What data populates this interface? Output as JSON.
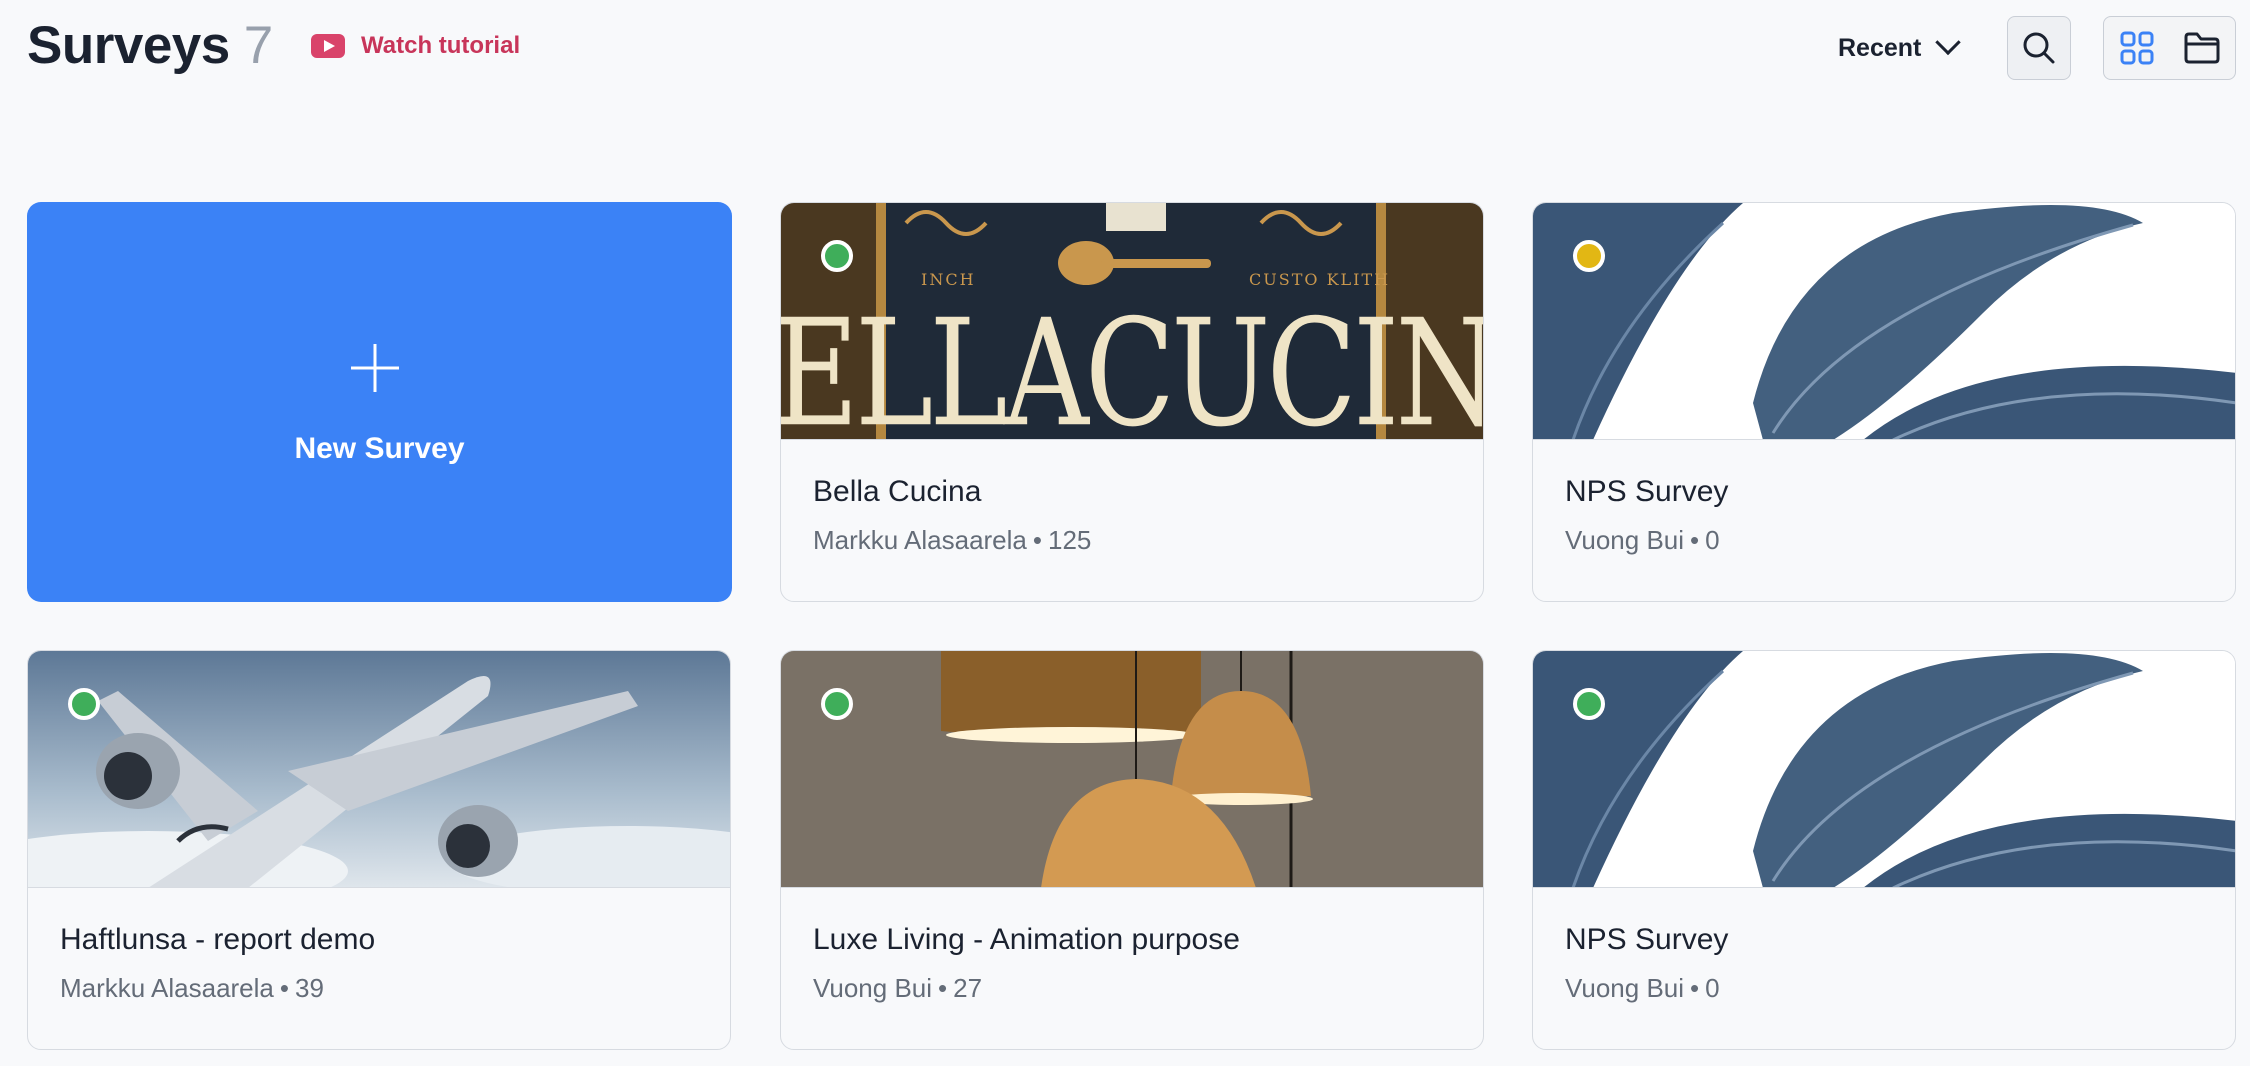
{
  "header": {
    "title": "Surveys",
    "count": "7",
    "tutorial_label": "Watch tutorial",
    "sort_label": "Recent"
  },
  "new_survey": {
    "label": "New Survey"
  },
  "status_colors": {
    "active": "#3fae5a",
    "paused": "#e2b714"
  },
  "accent": "#3b82f6",
  "cards": [
    {
      "name": "Bella Cucina",
      "author": "Markku Alasaarela",
      "responses": "125",
      "status": "active",
      "image": "bella-cucina-sign"
    },
    {
      "name": "NPS Survey",
      "author": "Vuong Bui",
      "responses": "0",
      "status": "paused",
      "image": "blue-leaves"
    },
    {
      "name": "Haftlunsa - report demo",
      "author": "Markku Alasaarela",
      "responses": "39",
      "status": "active",
      "image": "airplane-clouds"
    },
    {
      "name": "Luxe Living - Animation purpose",
      "author": "Vuong Bui",
      "responses": "27",
      "status": "active",
      "image": "pendant-lamps"
    },
    {
      "name": "NPS Survey",
      "author": "Vuong Bui",
      "responses": "0",
      "status": "active",
      "image": "blue-leaves"
    }
  ]
}
